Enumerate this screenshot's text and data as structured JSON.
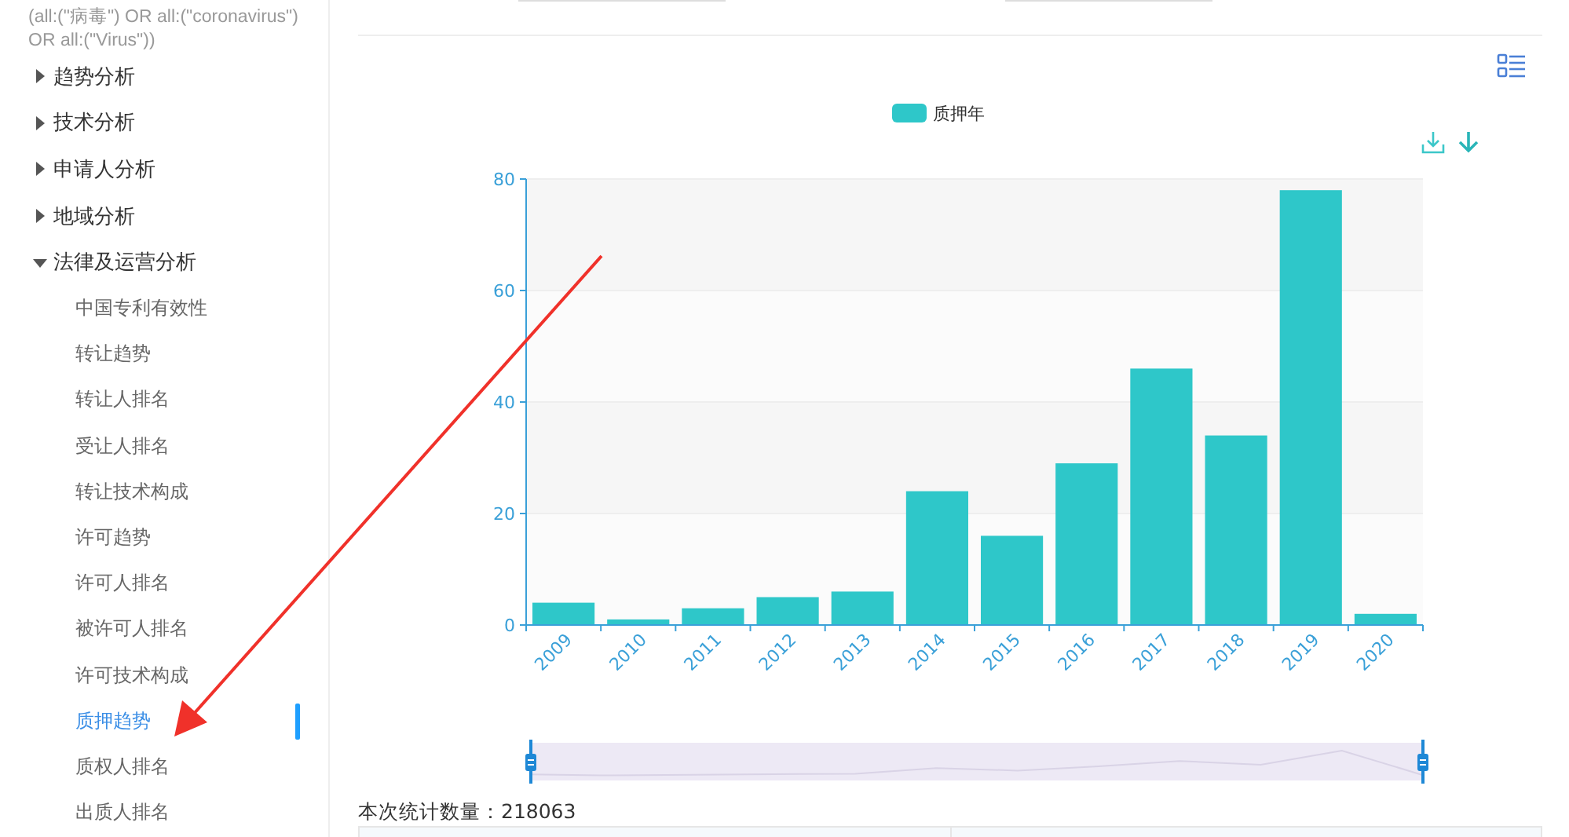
{
  "query": "(all:(\"病毒\") OR all:(\"coronavirus\") OR all:(\"Virus\"))",
  "nav": [
    {
      "label": "趋势分析",
      "expanded": false
    },
    {
      "label": "技术分析",
      "expanded": false
    },
    {
      "label": "申请人分析",
      "expanded": false
    },
    {
      "label": "地域分析",
      "expanded": false
    },
    {
      "label": "法律及运营分析",
      "expanded": true,
      "children": [
        {
          "label": "中国专利有效性",
          "selected": false
        },
        {
          "label": "转让趋势",
          "selected": false
        },
        {
          "label": "转让人排名",
          "selected": false
        },
        {
          "label": "受让人排名",
          "selected": false
        },
        {
          "label": "转让技术构成",
          "selected": false
        },
        {
          "label": "许可趋势",
          "selected": false
        },
        {
          "label": "许可人排名",
          "selected": false
        },
        {
          "label": "被许可人排名",
          "selected": false
        },
        {
          "label": "许可技术构成",
          "selected": false
        },
        {
          "label": "质押趋势",
          "selected": true
        },
        {
          "label": "质权人排名",
          "selected": false
        },
        {
          "label": "出质人排名",
          "selected": false
        }
      ]
    }
  ],
  "chart": {
    "chart_data": {
      "type": "bar",
      "categories": [
        "2009",
        "2010",
        "2011",
        "2012",
        "2013",
        "2014",
        "2015",
        "2016",
        "2017",
        "2018",
        "2019",
        "2020"
      ],
      "series": [
        {
          "name": "质押年",
          "color": "#2ec7c9",
          "values": [
            4,
            1,
            3,
            5,
            6,
            24,
            16,
            29,
            46,
            34,
            78,
            2
          ]
        }
      ],
      "ylim": [
        0,
        80
      ],
      "grid": true,
      "yticks": [
        0,
        20,
        40,
        60,
        80
      ]
    }
  },
  "summary": "本次统计数量：218063"
}
